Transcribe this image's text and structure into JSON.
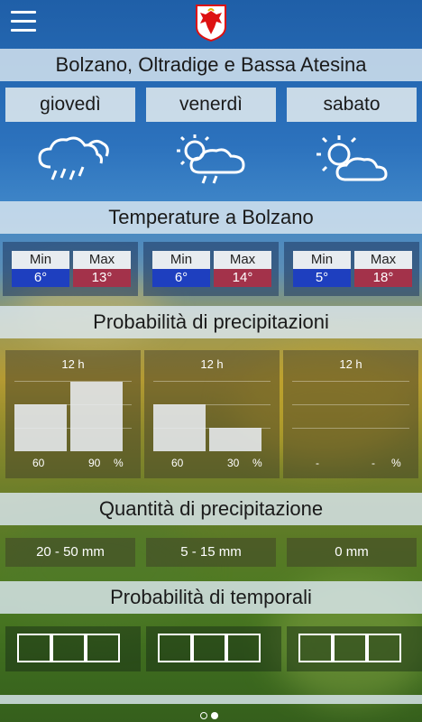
{
  "app": {
    "menu_icon": "hamburger-menu-icon",
    "logo_icon": "eagle-coat-of-arms-icon"
  },
  "region_title": "Bolzano, Oltradige e Bassa Atesina",
  "days": [
    {
      "label": "giovedì",
      "icon": "rain-cloud-icon"
    },
    {
      "label": "venerdì",
      "icon": "sun-rain-cloud-icon"
    },
    {
      "label": "sabato",
      "icon": "sun-cloud-icon"
    }
  ],
  "temperature": {
    "title": "Temperature a Bolzano",
    "min_label": "Min",
    "max_label": "Max",
    "values": [
      {
        "min": "6°",
        "max": "13°"
      },
      {
        "min": "6°",
        "max": "14°"
      },
      {
        "min": "5°",
        "max": "18°"
      }
    ]
  },
  "precip_probability": {
    "title": "Probabilità di precipitazioni",
    "hours_label": "12 h",
    "unit": "%",
    "values": [
      {
        "first": "60",
        "second": "90",
        "first_pct": 60,
        "second_pct": 90
      },
      {
        "first": "60",
        "second": "30",
        "first_pct": 60,
        "second_pct": 30
      },
      {
        "first": "-",
        "second": "-",
        "first_pct": 0,
        "second_pct": 0
      }
    ]
  },
  "precip_amount": {
    "title": "Quantità di precipitazione",
    "values": [
      "20 - 50 mm",
      "5 - 15 mm",
      "0 mm"
    ]
  },
  "storm_probability": {
    "title": "Probabilità di temporali"
  },
  "pager": {
    "pages": 2,
    "active": 2
  },
  "colors": {
    "min_blue": "#1e3fbf",
    "max_red": "#a3324a",
    "band": "#dce8f0"
  }
}
